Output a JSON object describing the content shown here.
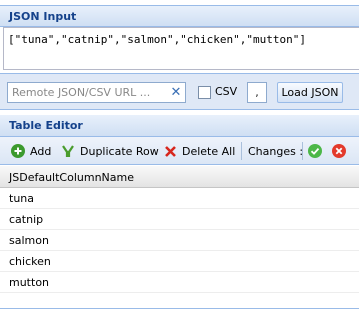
{
  "json_panel": {
    "title": "JSON Input",
    "content": "[\"tuna\",\"catnip\",\"salmon\",\"chicken\",\"mutton\"]"
  },
  "remote": {
    "url_placeholder": "Remote JSON/CSV URL ...",
    "clear_icon": "clear-icon",
    "csv_label": "CSV",
    "csv_checked": false,
    "delimiter": ",",
    "load_label": "Load JSON"
  },
  "table_panel": {
    "title": "Table Editor",
    "toolbar": {
      "add_label": "Add",
      "duplicate_label": "Duplicate Row",
      "delete_all_label": "Delete All",
      "changes_label": "Changes :"
    },
    "column_header": "JSDefaultColumnName",
    "rows": [
      "tuna",
      "catnip",
      "salmon",
      "chicken",
      "mutton"
    ]
  },
  "colors": {
    "header_text": "#15428b",
    "add_green": "#3c9a2e",
    "delete_red": "#d7261d",
    "accept_green": "#4cb748",
    "reject_red": "#e33a2c"
  }
}
